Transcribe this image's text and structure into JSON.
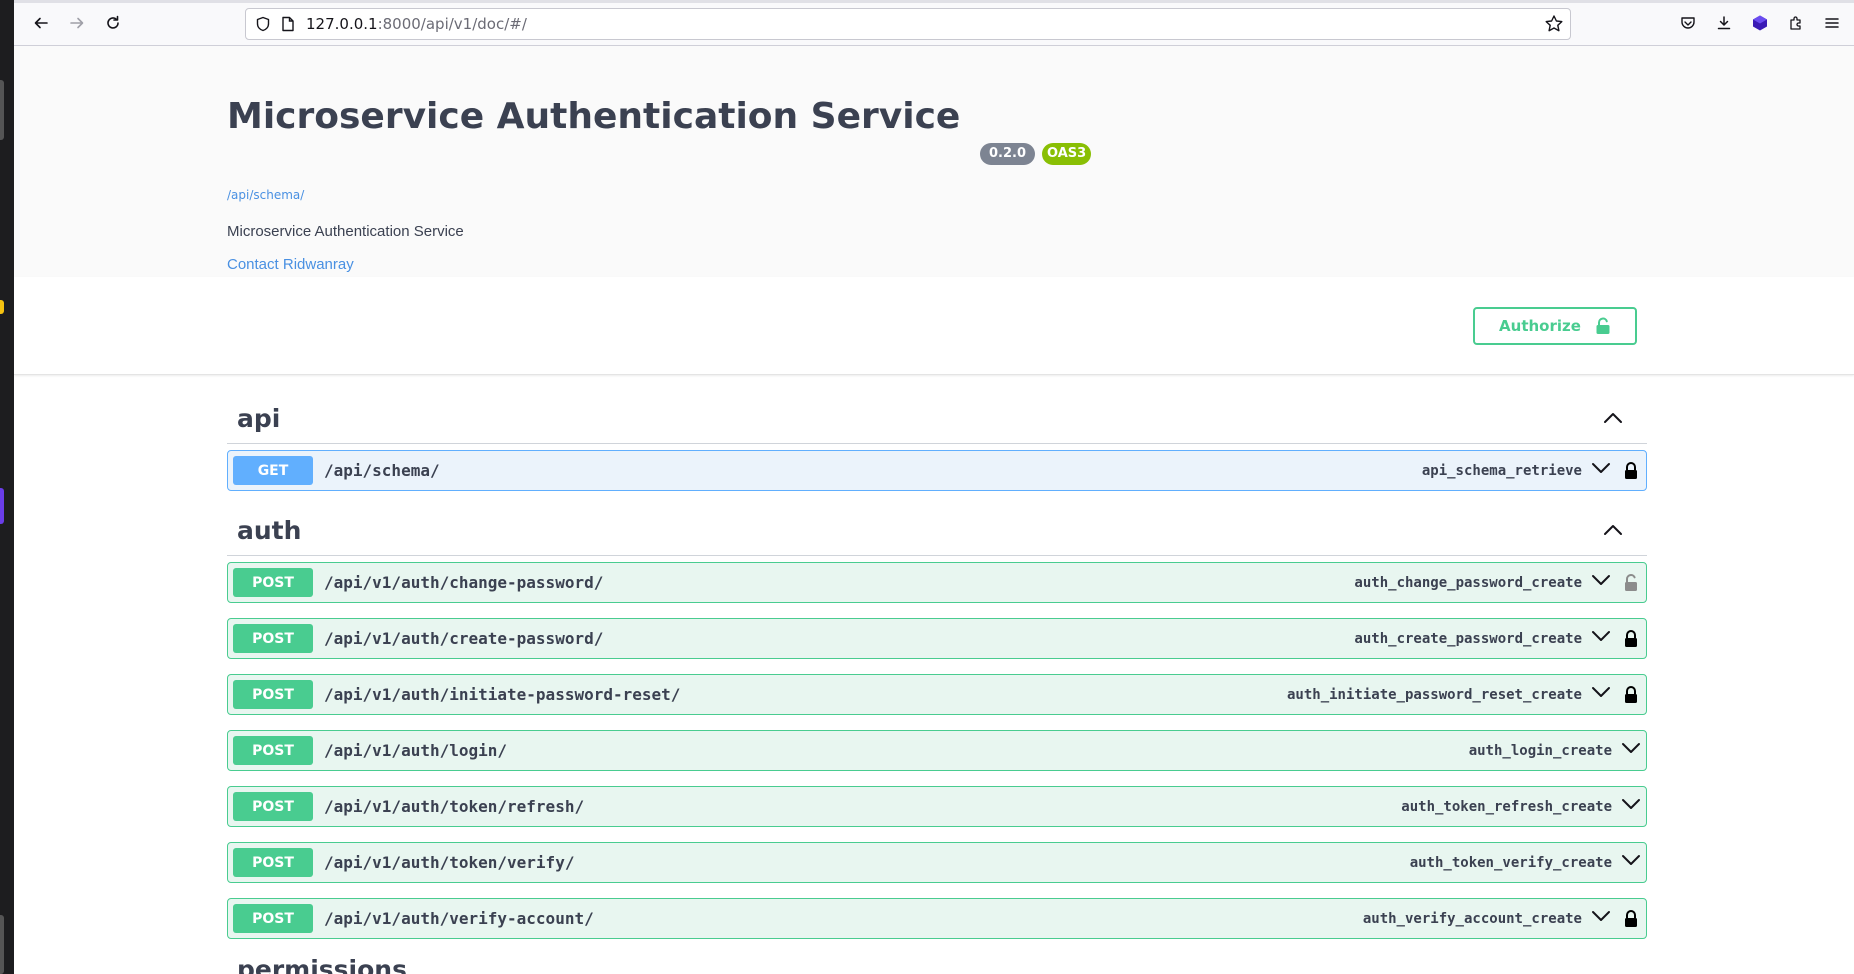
{
  "browser": {
    "url_host": "127.0.0.1",
    "url_rest": ":8000/api/v1/doc/#/"
  },
  "info": {
    "title": "Microservice Authentication Service",
    "version": "0.2.0",
    "oas": "OAS3",
    "schema_link": "/api/schema/",
    "description": "Microservice Authentication Service",
    "contact": "Contact Ridwanray"
  },
  "authorize_label": "Authorize",
  "tags": [
    {
      "name": "api",
      "operations": [
        {
          "method": "GET",
          "path": "/api/schema/",
          "operation_id": "api_schema_retrieve",
          "lock": "locked"
        }
      ]
    },
    {
      "name": "auth",
      "operations": [
        {
          "method": "POST",
          "path": "/api/v1/auth/change-password/",
          "operation_id": "auth_change_password_create",
          "lock": "unlocked"
        },
        {
          "method": "POST",
          "path": "/api/v1/auth/create-password/",
          "operation_id": "auth_create_password_create",
          "lock": "locked"
        },
        {
          "method": "POST",
          "path": "/api/v1/auth/initiate-password-reset/",
          "operation_id": "auth_initiate_password_reset_create",
          "lock": "locked"
        },
        {
          "method": "POST",
          "path": "/api/v1/auth/login/",
          "operation_id": "auth_login_create",
          "lock": "none"
        },
        {
          "method": "POST",
          "path": "/api/v1/auth/token/refresh/",
          "operation_id": "auth_token_refresh_create",
          "lock": "none"
        },
        {
          "method": "POST",
          "path": "/api/v1/auth/token/verify/",
          "operation_id": "auth_token_verify_create",
          "lock": "none"
        },
        {
          "method": "POST",
          "path": "/api/v1/auth/verify-account/",
          "operation_id": "auth_verify_account_create",
          "lock": "locked"
        }
      ]
    }
  ],
  "next_tag": "permissions",
  "colors": {
    "get": "#61affe",
    "post": "#49cc90",
    "link": "#4990e2",
    "oas_badge": "#89bf04"
  }
}
